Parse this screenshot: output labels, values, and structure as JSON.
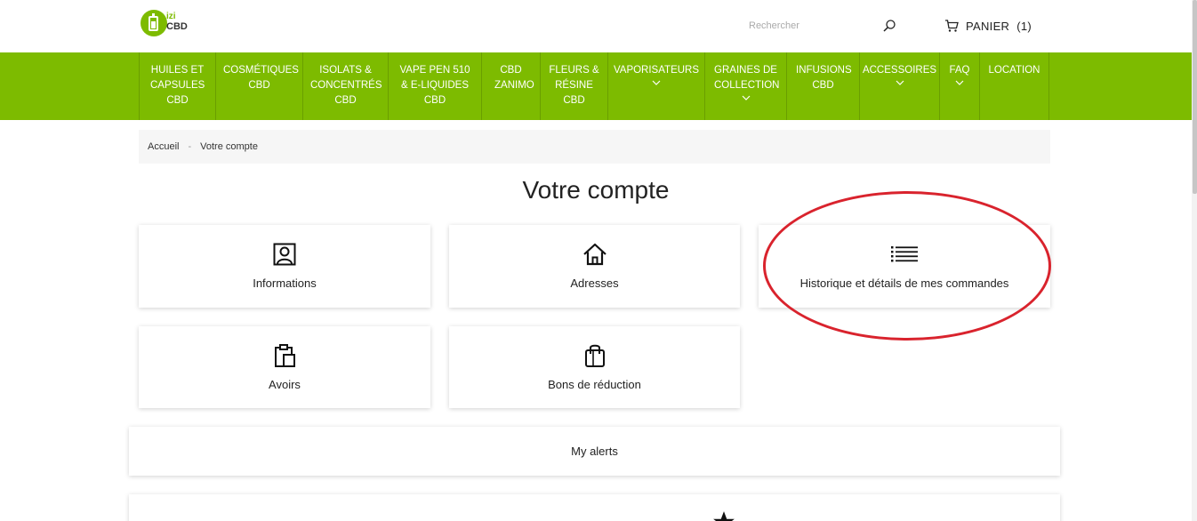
{
  "header": {
    "logo_top": "izi",
    "logo_bottom": "CBD",
    "search_placeholder": "Rechercher",
    "cart_label": "PANIER",
    "cart_count": "(1)"
  },
  "nav": [
    {
      "label": "HUILES ET CAPSULES CBD",
      "has_dropdown": false
    },
    {
      "label": "COSMÉTIQUES CBD",
      "has_dropdown": false
    },
    {
      "label": "ISOLATS & CONCENTRÉS CBD",
      "has_dropdown": false
    },
    {
      "label": "VAPE PEN 510 & E-LIQUIDES CBD",
      "has_dropdown": false
    },
    {
      "label": "CBD ZANIMO",
      "has_dropdown": false
    },
    {
      "label": "FLEURS & RÉSINE CBD",
      "has_dropdown": false
    },
    {
      "label": "VAPORISATEURS",
      "has_dropdown": true
    },
    {
      "label": "GRAINES DE COLLECTION",
      "has_dropdown": true
    },
    {
      "label": "INFUSIONS CBD",
      "has_dropdown": false
    },
    {
      "label": "ACCESSOIRES",
      "has_dropdown": true
    },
    {
      "label": "FAQ",
      "has_dropdown": true
    },
    {
      "label": "LOCATION",
      "has_dropdown": false
    }
  ],
  "breadcrumb": {
    "home": "Accueil",
    "separator": "-",
    "current": "Votre compte"
  },
  "page_title": "Votre compte",
  "cards": {
    "informations": "Informations",
    "adresses": "Adresses",
    "historique": "Historique et détails de mes commandes",
    "avoirs": "Avoirs",
    "bons": "Bons de réduction"
  },
  "my_alerts": "My alerts",
  "colors": {
    "brand_green": "#7dbb00",
    "annotation_red": "#d9232d"
  }
}
